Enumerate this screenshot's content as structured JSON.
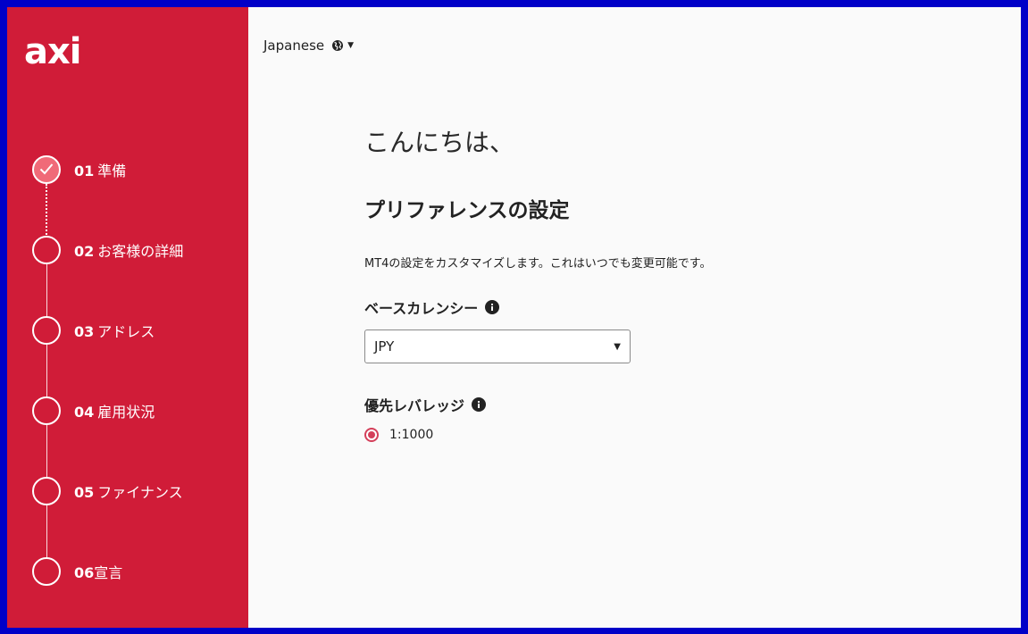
{
  "brand": {
    "logo_text": "axi",
    "accent_color": "#d01c38"
  },
  "language": {
    "selected": "Japanese",
    "icon": "globe-icon"
  },
  "steps": [
    {
      "num": "01",
      "label": "準備",
      "status": "completed"
    },
    {
      "num": "02",
      "label": "お客様の詳細",
      "status": "pending"
    },
    {
      "num": "03",
      "label": "アドレス",
      "status": "pending"
    },
    {
      "num": "04",
      "label": "雇用状況",
      "status": "pending"
    },
    {
      "num": "05",
      "label": "ファイナンス",
      "status": "pending"
    },
    {
      "num": "06",
      "label": "宣言",
      "status": "pending"
    }
  ],
  "main": {
    "greeting": "こんにちは、",
    "heading": "プリファレンスの設定",
    "description": "MT4の設定をカスタマイズします。これはいつでも変更可能です。",
    "base_currency": {
      "label": "ベースカレンシー",
      "value": "JPY"
    },
    "leverage": {
      "label": "優先レバレッジ",
      "options": [
        {
          "label": "1:1000",
          "selected": true
        }
      ]
    }
  }
}
